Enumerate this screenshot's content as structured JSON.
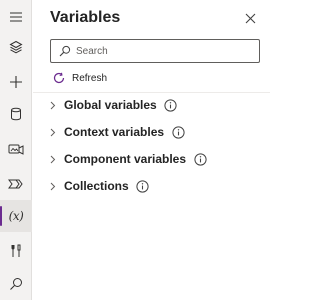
{
  "rail": {
    "items": [
      {
        "name": "hamburger-menu-icon"
      },
      {
        "name": "layers-icon"
      },
      {
        "name": "plus-icon"
      },
      {
        "name": "database-icon"
      },
      {
        "name": "media-icon"
      },
      {
        "name": "power-automate-icon"
      },
      {
        "name": "variables-icon",
        "glyph": "(x)",
        "active": true
      },
      {
        "name": "tools-icon"
      },
      {
        "name": "search-icon"
      }
    ]
  },
  "panel": {
    "title": "Variables",
    "search": {
      "placeholder": "Search",
      "value": ""
    },
    "refresh_label": "Refresh",
    "sections": [
      {
        "label": "Global variables"
      },
      {
        "label": "Context variables"
      },
      {
        "label": "Component variables"
      },
      {
        "label": "Collections"
      }
    ]
  },
  "colors": {
    "rail_background": "#f3f2f1",
    "accent": "#6b2b8f",
    "text": "#242424",
    "border": "#605e5c"
  }
}
